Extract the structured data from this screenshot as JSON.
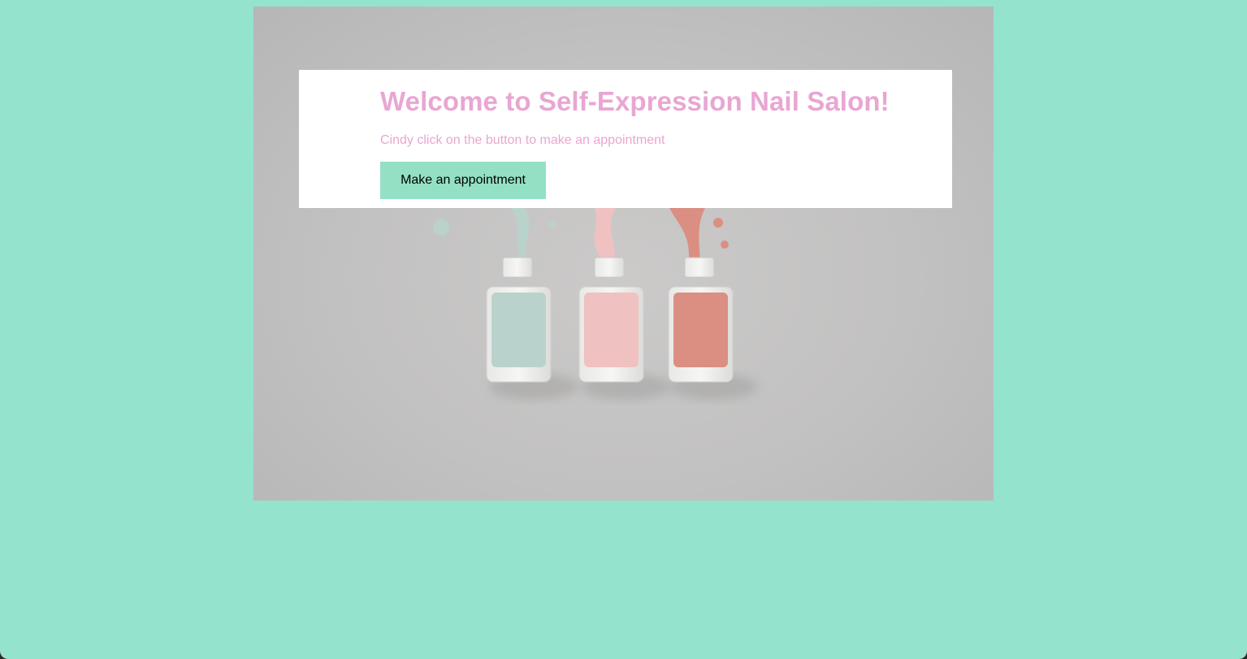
{
  "colors": {
    "background": "#94e3cd",
    "accent_text": "#e9a6d2",
    "button": "#94e0c4",
    "card": "#ffffff"
  },
  "hero": {
    "image": "nail-polish-bottles-photo",
    "polish_colors": [
      "#b9d3cc",
      "#efc1c0",
      "#db8e82"
    ]
  },
  "welcome": {
    "title": "Welcome to Self-Expression Nail Salon!",
    "subtitle": "Cindy click on the button to make an appointment",
    "button_label": "Make an appointment"
  }
}
